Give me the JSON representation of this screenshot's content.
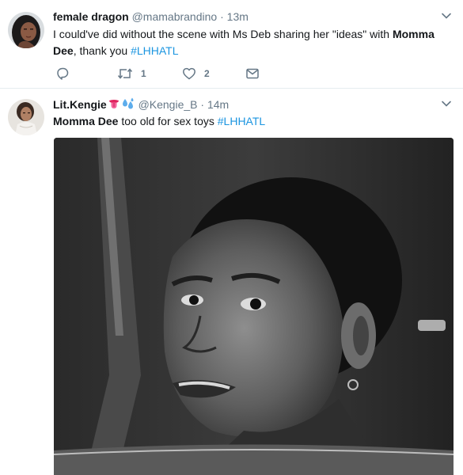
{
  "tweets": [
    {
      "name": "female dragon",
      "handle": "@mamabrandino",
      "separator": "·",
      "time": "13m",
      "text_before": "I could've did without the scene with Ms Deb sharing her \"ideas\" with ",
      "text_mention": "Momma Dee",
      "text_after": ", thank you  ",
      "hashtag": "#LHHATL",
      "actions": {
        "reply_icon": "reply-icon",
        "retweet_icon": "retweet-icon",
        "retweet_count": "1",
        "like_icon": "heart-icon",
        "like_count": "2",
        "dm_icon": "envelope-icon"
      }
    },
    {
      "name": "Lit.Kengie",
      "name_emojis": [
        "tongue-emoji",
        "sweat-droplets-emoji"
      ],
      "handle": "@Kengie_B",
      "separator": "·",
      "time": "14m",
      "text_mention": "Momma Dee",
      "text_after": " too old for sex toys ",
      "hashtag": "#LHHATL",
      "media": "grayscale-gif-woman-looking-over-shoulder"
    }
  ],
  "colors": {
    "link": "#1b95e0",
    "secondary_text": "#657786",
    "primary_text": "#14171a",
    "divider": "#e6ecf0"
  }
}
